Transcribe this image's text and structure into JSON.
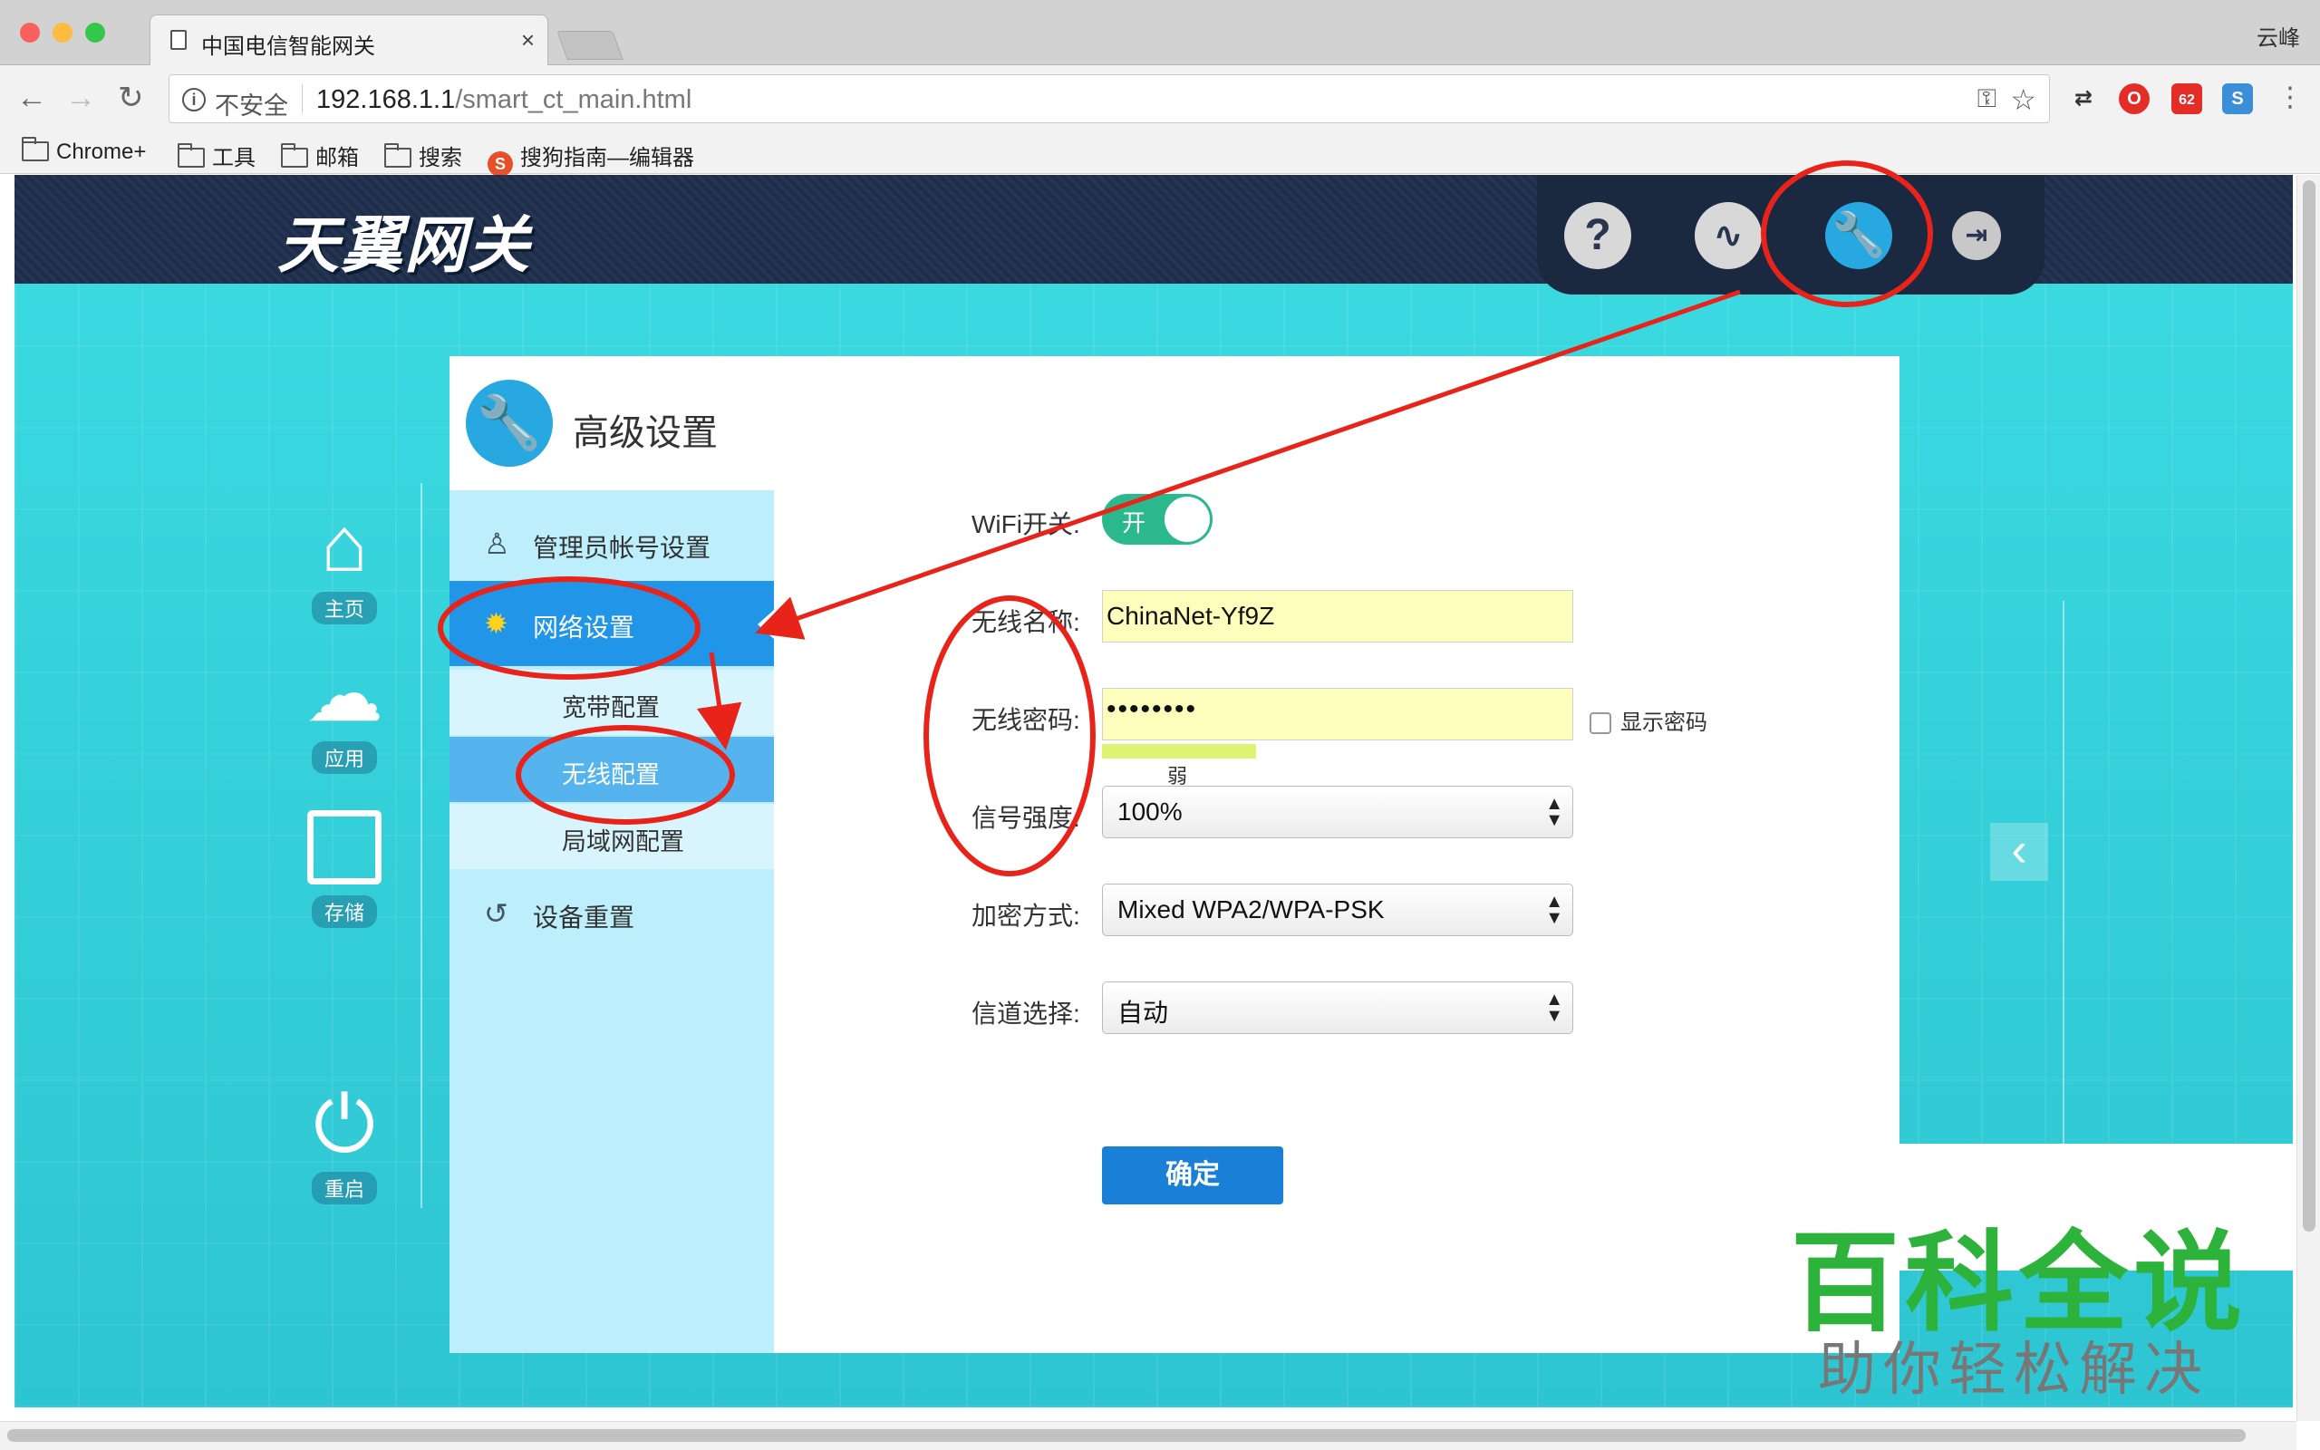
{
  "browser": {
    "tab_title": "中国电信智能网关",
    "tab_close": "×",
    "user_name": "云峰",
    "insecure_label": "不安全",
    "url_host": "192.168.1.1",
    "url_path": "/smart_ct_main.html",
    "bookmarks": [
      "Chrome+",
      "工具",
      "邮箱",
      "搜索",
      "搜狗指南—编辑器"
    ],
    "ext_badge": "62"
  },
  "header": {
    "logo": "天翼网关",
    "icons": [
      "help-icon",
      "stats-icon",
      "settings-icon",
      "logout-icon"
    ]
  },
  "rail": {
    "home": "主页",
    "apps": "应用",
    "storage": "存储",
    "restart": "重启"
  },
  "menu": {
    "title": "高级设置",
    "admin": "管理员帐号设置",
    "network": "网络设置",
    "sub_broadband": "宽带配置",
    "sub_wireless": "无线配置",
    "sub_lan": "局域网配置",
    "reset": "设备重置"
  },
  "form": {
    "wifi_label": "WiFi开关:",
    "wifi_state": "开",
    "ssid_label": "无线名称:",
    "ssid_value": "ChinaNet-Yf9Z",
    "pwd_label": "无线密码:",
    "pwd_value": "••••••••",
    "show_pwd_label": "显示密码",
    "strength_text": "弱",
    "signal_label": "信号强度:",
    "signal_value": "100%",
    "enc_label": "加密方式:",
    "enc_value": "Mixed WPA2/WPA-PSK",
    "chan_label": "信道选择:",
    "chan_value": "自动",
    "submit_label": "确定"
  },
  "watermark": {
    "main": "百科全说",
    "sub": "助你轻松解决"
  },
  "colors": {
    "accent": "#2196e8",
    "header_bg": "#1e2e4a",
    "page_bg": "#3ad9e0",
    "toggle_on": "#2bb88c",
    "annotation": "#e8231a",
    "watermark_green": "#2db23b"
  }
}
